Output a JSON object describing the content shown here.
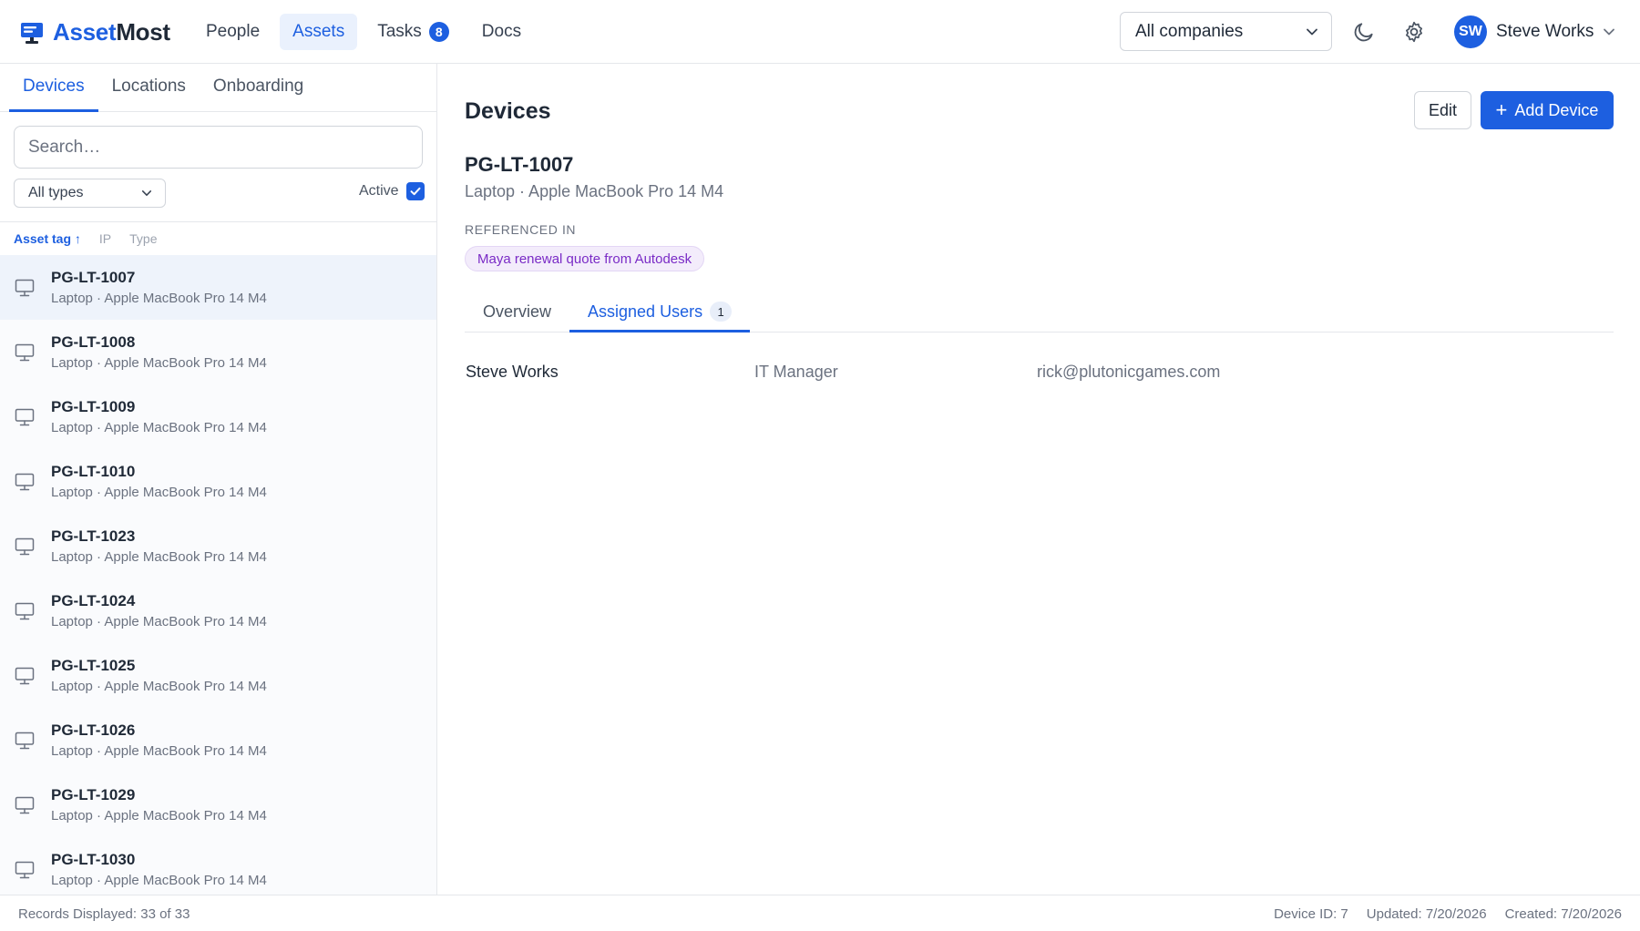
{
  "app": {
    "name_part1": "Asset",
    "name_part2": "Most",
    "logo_icon": "monitor-logo-icon",
    "accent_color": "#1d5fe0"
  },
  "nav": {
    "items": [
      {
        "label": "People",
        "active": false
      },
      {
        "label": "Assets",
        "active": true
      },
      {
        "label": "Tasks",
        "active": false,
        "badge": "8"
      },
      {
        "label": "Docs",
        "active": false
      }
    ]
  },
  "header": {
    "company_select": "All companies",
    "theme_icon": "moon-icon",
    "settings_icon": "gear-icon",
    "user": {
      "initials": "SW",
      "name": "Steve Works"
    }
  },
  "sidebar": {
    "tabs": [
      {
        "label": "Devices",
        "active": true
      },
      {
        "label": "Locations",
        "active": false
      },
      {
        "label": "Onboarding",
        "active": false
      }
    ],
    "search_placeholder": "Search…",
    "type_filter": "All types",
    "active_label": "Active",
    "active_checked": true,
    "sort_columns": [
      {
        "label": "Asset tag ↑",
        "active": true
      },
      {
        "label": "IP",
        "active": false
      },
      {
        "label": "Type",
        "active": false
      }
    ],
    "devices": [
      {
        "tag": "PG-LT-1007",
        "desc": "Laptop · Apple MacBook Pro 14 M4",
        "selected": true
      },
      {
        "tag": "PG-LT-1008",
        "desc": "Laptop · Apple MacBook Pro 14 M4",
        "selected": false
      },
      {
        "tag": "PG-LT-1009",
        "desc": "Laptop · Apple MacBook Pro 14 M4",
        "selected": false
      },
      {
        "tag": "PG-LT-1010",
        "desc": "Laptop · Apple MacBook Pro 14 M4",
        "selected": false
      },
      {
        "tag": "PG-LT-1023",
        "desc": "Laptop · Apple MacBook Pro 14 M4",
        "selected": false
      },
      {
        "tag": "PG-LT-1024",
        "desc": "Laptop · Apple MacBook Pro 14 M4",
        "selected": false
      },
      {
        "tag": "PG-LT-1025",
        "desc": "Laptop · Apple MacBook Pro 14 M4",
        "selected": false
      },
      {
        "tag": "PG-LT-1026",
        "desc": "Laptop · Apple MacBook Pro 14 M4",
        "selected": false
      },
      {
        "tag": "PG-LT-1029",
        "desc": "Laptop · Apple MacBook Pro 14 M4",
        "selected": false
      },
      {
        "tag": "PG-LT-1030",
        "desc": "Laptop · Apple MacBook Pro 14 M4",
        "selected": false
      }
    ]
  },
  "main": {
    "title": "Devices",
    "edit_label": "Edit",
    "add_label": "Add Device",
    "device": {
      "tag": "PG-LT-1007",
      "subtitle": "Laptop · Apple MacBook Pro 14 M4",
      "referenced_label": "Referenced in",
      "reference": "Maya renewal quote from Autodesk"
    },
    "tabs": [
      {
        "label": "Overview",
        "active": false
      },
      {
        "label": "Assigned Users",
        "active": true,
        "count": "1"
      }
    ],
    "assigned_user": {
      "name": "Steve Works",
      "role": "IT Manager",
      "email": "rick@plutonicgames.com"
    }
  },
  "footer": {
    "records": "Records Displayed: 33 of 33",
    "device_id": "Device ID: 7",
    "updated": "Updated: 7/20/2026",
    "created": "Created: 7/20/2026"
  }
}
